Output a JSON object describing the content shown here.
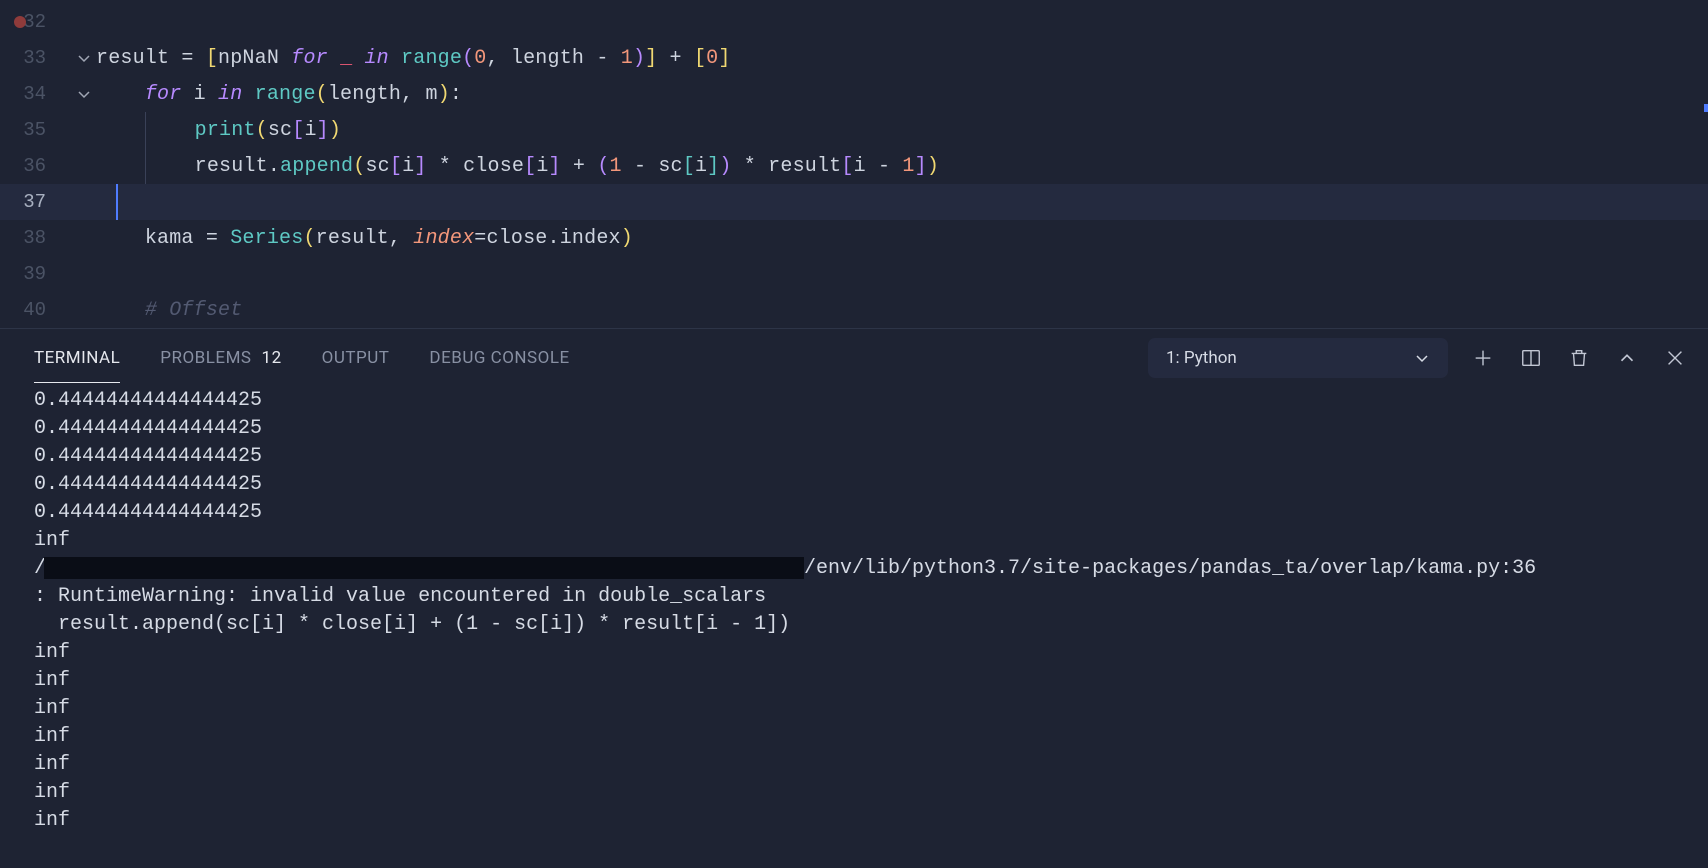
{
  "editor": {
    "lines": [
      {
        "num": "32"
      },
      {
        "num": "33"
      },
      {
        "num": "34"
      },
      {
        "num": "35"
      },
      {
        "num": "36"
      },
      {
        "num": "37"
      },
      {
        "num": "38"
      },
      {
        "num": "39"
      },
      {
        "num": "40"
      }
    ],
    "tokens": {
      "result": "result",
      "eq": "=",
      "lbrack": "[",
      "rbrack": "]",
      "npNaN": "npNaN",
      "for": "for",
      "underscore": "_",
      "in": "in",
      "range": "range",
      "lparen": "(",
      "rparen": ")",
      "zero": "0",
      "comma": ",",
      "length": "length",
      "minus": "-",
      "plus": "+",
      "one": "1",
      "i": "i",
      "m": "m",
      "colon": ":",
      "print": "print",
      "sc": "sc",
      "mult": "*",
      "close": "close",
      "append": "append",
      "dot": ".",
      "kama": "kama",
      "Series": "Series",
      "index": "index",
      "comment": "# Offset"
    }
  },
  "panel": {
    "tabs": {
      "terminal": "TERMINAL",
      "problems": "PROBLEMS",
      "problems_count": "12",
      "output": "OUTPUT",
      "debug": "DEBUG CONSOLE"
    },
    "terminal_select": "1: Python"
  },
  "terminal": {
    "lines": [
      "0.44444444444444425",
      "0.44444444444444425",
      "0.44444444444444425",
      "0.44444444444444425",
      "0.44444444444444425",
      "inf"
    ],
    "path_prefix": "/",
    "path_suffix": "/env/lib/python3.7/site-packages/pandas_ta/overlap/kama.py:36",
    "warning_line1": ": RuntimeWarning: invalid value encountered in double_scalars",
    "warning_line2": "  result.append(sc[i] * close[i] + (1 - sc[i]) * result[i - 1])",
    "inf_lines": [
      "inf",
      "inf",
      "inf",
      "inf",
      "inf",
      "inf",
      "inf"
    ]
  }
}
